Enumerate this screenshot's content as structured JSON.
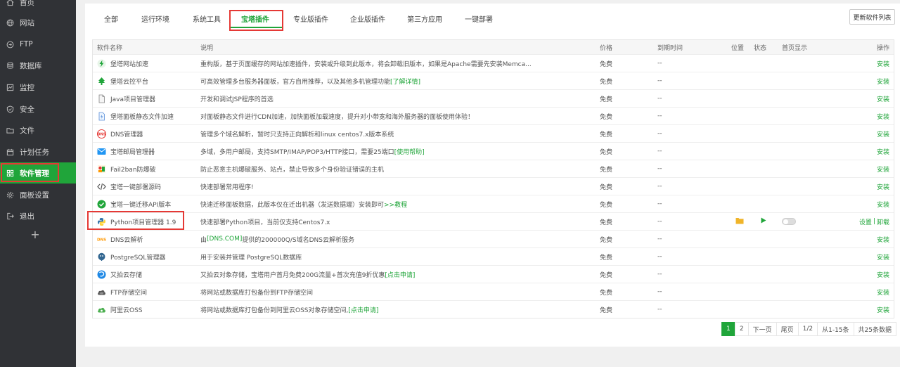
{
  "sidebar": {
    "items": [
      {
        "label": "首页",
        "icon": "home-icon"
      },
      {
        "label": "网站",
        "icon": "globe-icon"
      },
      {
        "label": "FTP",
        "icon": "ftp-icon"
      },
      {
        "label": "数据库",
        "icon": "database-icon"
      },
      {
        "label": "监控",
        "icon": "monitor-icon"
      },
      {
        "label": "安全",
        "icon": "shield-icon"
      },
      {
        "label": "文件",
        "icon": "folder-icon"
      },
      {
        "label": "计划任务",
        "icon": "calendar-icon"
      },
      {
        "label": "软件管理",
        "icon": "grid-icon",
        "active": true
      },
      {
        "label": "面板设置",
        "icon": "gear-icon"
      },
      {
        "label": "退出",
        "icon": "logout-icon"
      }
    ],
    "add_label": "+"
  },
  "tabs": [
    "全部",
    "运行环境",
    "系统工具",
    "宝塔插件",
    "专业版插件",
    "企业版插件",
    "第三方应用",
    "一键部署"
  ],
  "active_tab": "宝塔插件",
  "update_button": "更新软件列表",
  "table": {
    "headers": {
      "name": "软件名称",
      "desc": "说明",
      "price": "价格",
      "expire": "到期时间",
      "position": "位置",
      "state": "状态",
      "home": "首页显示",
      "op": "操作"
    },
    "rows": [
      {
        "name": "堡塔网站加速",
        "desc": "重构版，基于页面缓存的网站加速插件，安装或升级到此版本，将会卸载旧版本，如果是Apache需要先安装Memca...",
        "link": "",
        "price": "免费",
        "expire": "--",
        "op": "安装"
      },
      {
        "name": "堡塔云控平台",
        "desc": "可高效管理多台服务器面板，官方自用推荐，以及其他多机管理功能 ",
        "link": "[了解详情]",
        "price": "免费",
        "expire": "--",
        "op": "安装"
      },
      {
        "name": "Java项目管理器",
        "desc": "开发和调试JSP程序的首选",
        "link": "",
        "price": "免费",
        "expire": "--",
        "op": "安装"
      },
      {
        "name": "堡塔面板静态文件加速",
        "desc": "对面板静态文件进行CDN加速，加快面板加载速度，提升对小带宽和海外服务器的面板使用体验！",
        "link": "",
        "price": "免费",
        "expire": "--",
        "op": "安装"
      },
      {
        "name": "DNS管理器",
        "desc": "管理多个域名解析，暂时只支持正向解析和linux centos7.x版本系统",
        "link": "",
        "price": "免费",
        "expire": "--",
        "op": "安装"
      },
      {
        "name": "宝塔邮局管理器",
        "desc": "多域，多用户邮局，支持SMTP/IMAP/POP3/HTTP接口，需要25端口 ",
        "link": "[使用帮助]",
        "price": "免费",
        "expire": "--",
        "op": "安装"
      },
      {
        "name": "Fail2ban防爆破",
        "desc": "防止恶意主机爆破服务、站点，禁止导致多个身份验证错误的主机",
        "link": "",
        "price": "免费",
        "expire": "--",
        "op": "安装"
      },
      {
        "name": "宝塔一键部署源码",
        "desc": "快速部署常用程序!",
        "link": "",
        "price": "免费",
        "expire": "--",
        "op": "安装"
      },
      {
        "name": "宝塔一键迁移API版本",
        "desc": "快速迁移面板数据，此版本仅在迁出机器（发送数据端）安装即可",
        "link": ">>教程",
        "price": "免费",
        "expire": "--",
        "op": "安装"
      },
      {
        "name": "Python项目管理器 1.9",
        "desc": "快速部署Python项目，当前仅支持Centos7.x",
        "link": "",
        "price": "免费",
        "expire": "--",
        "op": "",
        "installed": true,
        "op_settings": "设置",
        "op_sep": "|",
        "op_uninstall": "卸载"
      },
      {
        "name": "DNS云解析",
        "desc": "由",
        "link": "[DNS.COM]",
        "desc_after": "提供的200000Q/S域名DNS云解析服务",
        "price": "免费",
        "expire": "--",
        "op": "安装"
      },
      {
        "name": "PostgreSQL管理器",
        "desc": "用于安装并管理 PostgreSQL数据库",
        "link": "",
        "price": "免费",
        "expire": "--",
        "op": "安装"
      },
      {
        "name": "又拍云存储",
        "desc": "又拍云对象存储，宝塔用户首月免费200G流量+首次充值9折优惠 ",
        "link": "[点击申请]",
        "price": "免费",
        "expire": "--",
        "op": "安装"
      },
      {
        "name": "FTP存储空间",
        "desc": "将网站或数据库打包备份到FTP存储空间",
        "link": "",
        "price": "免费",
        "expire": "--",
        "op": "安装"
      },
      {
        "name": "阿里云OSS",
        "desc": "将网站或数据库打包备份到阿里云OSS对象存储空间, ",
        "link": "[点击申请]",
        "price": "免费",
        "expire": "--",
        "op": "安装"
      }
    ]
  },
  "pagination": {
    "pages": [
      "1",
      "2"
    ],
    "current": "1",
    "next": "下一页",
    "last": "尾页",
    "page_info": "1/2",
    "range": "从1-15条",
    "total": "共25条数据"
  }
}
